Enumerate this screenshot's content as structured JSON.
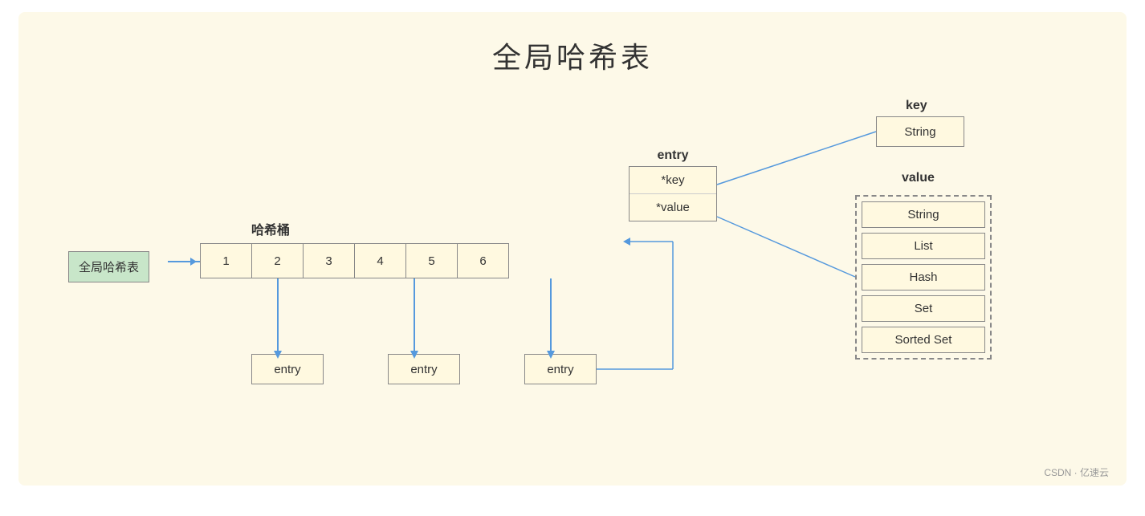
{
  "title": "全局哈希表",
  "global_ht_label": "全局哈希表",
  "bucket_label": "哈希桶",
  "buckets": [
    "1",
    "2",
    "3",
    "4",
    "5",
    "6"
  ],
  "entry_label": "entry",
  "entry_fields": [
    "*key",
    "*value"
  ],
  "bottom_entries": [
    "entry",
    "entry",
    "entry"
  ],
  "key_label": "key",
  "key_type": "String",
  "value_label": "value",
  "value_types": [
    "String",
    "List",
    "Hash",
    "Set",
    "Sorted Set"
  ],
  "footer_text": "CSDN · 亿速云"
}
